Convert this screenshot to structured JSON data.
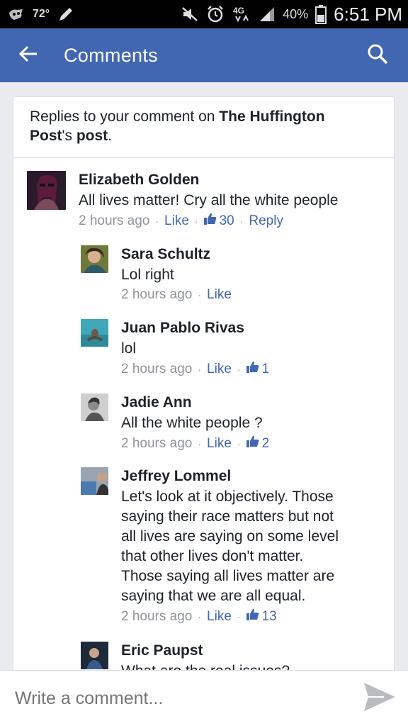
{
  "status_bar": {
    "temperature": "72°",
    "battery": "40%",
    "time": "6:51 PM"
  },
  "app_bar": {
    "title": "Comments",
    "back_icon": "arrow-left-icon",
    "search_icon": "search-icon",
    "color": "#4267b2"
  },
  "header": {
    "prefix": "Replies to your comment on ",
    "page_name_a": "The Huffington",
    "page_name_b": "Post",
    "suffix_a": "'s ",
    "suffix_b": "post",
    "suffix_c": "."
  },
  "meta_labels": {
    "like": "Like",
    "reply": "Reply",
    "separator": "·"
  },
  "comments": [
    {
      "author": "Elizabeth Golden",
      "text": "All lives matter! Cry all the white people",
      "time": "2 hours ago",
      "likes": "30"
    },
    {
      "author": "Sara Schultz",
      "text": "Lol right",
      "time": "2 hours ago"
    },
    {
      "author": "Juan Pablo Rivas",
      "text": "lol",
      "time": "2 hours ago",
      "likes": "1"
    },
    {
      "author": "Jadie Ann",
      "text": "All the white people ?",
      "time": "2 hours ago",
      "likes": "2"
    },
    {
      "author": "Jeffrey Lommel",
      "text_lines": [
        "Let's look at it objectively. Those",
        "saying their race matters but not",
        "all lives are saying on some level",
        "that other lives don't matter.",
        "Those saying all lives matter are",
        "saying that we are all equal."
      ],
      "time": "2 hours ago",
      "likes": "13"
    },
    {
      "author": "Eric Paupst",
      "text": "What are the real issues?"
    }
  ],
  "composer": {
    "placeholder": "Write a comment...",
    "send_icon": "send-icon"
  }
}
